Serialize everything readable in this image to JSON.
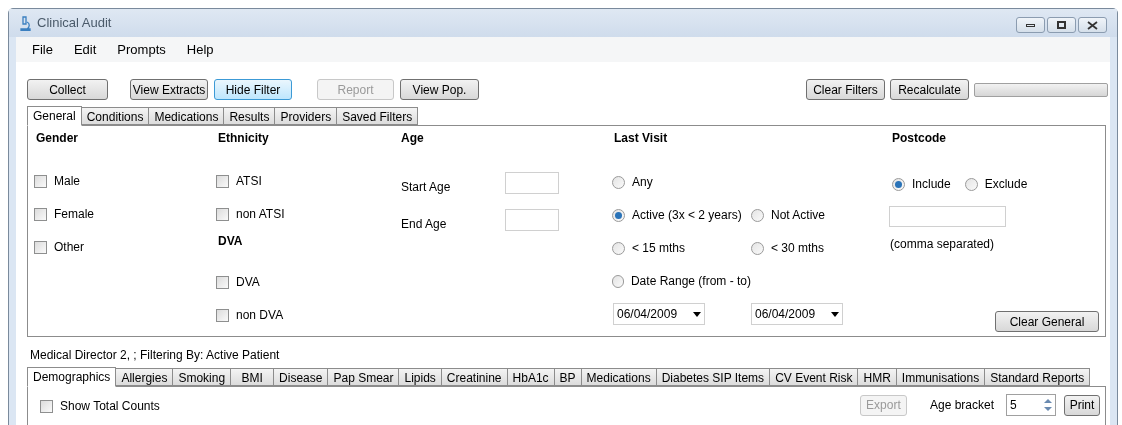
{
  "window": {
    "title": "Clinical Audit"
  },
  "menu": [
    "File",
    "Edit",
    "Prompts",
    "Help"
  ],
  "toolbar_left": [
    {
      "label": "Collect",
      "disabled": false,
      "focused": false
    },
    {
      "label": "View Extracts",
      "disabled": false,
      "focused": false
    },
    {
      "label": "Hide Filter",
      "disabled": false,
      "focused": true
    },
    {
      "label": "Report",
      "disabled": true,
      "focused": false
    },
    {
      "label": "View Pop.",
      "disabled": false,
      "focused": false
    }
  ],
  "toolbar_right": [
    {
      "label": "Clear Filters",
      "disabled": false,
      "focused": false
    },
    {
      "label": "Recalculate",
      "disabled": false,
      "focused": false
    }
  ],
  "progress": {
    "level": 0
  },
  "filter_tabs": [
    {
      "label": "General",
      "selected": true
    },
    {
      "label": "Conditions",
      "selected": false
    },
    {
      "label": "Medications",
      "selected": false
    },
    {
      "label": "Results",
      "selected": false
    },
    {
      "label": "Providers",
      "selected": false
    },
    {
      "label": "Saved Filters",
      "selected": false
    }
  ],
  "gender": {
    "heading": "Gender",
    "options": [
      {
        "label": "Male",
        "checked": false
      },
      {
        "label": "Female",
        "checked": false
      },
      {
        "label": "Other",
        "checked": false
      }
    ]
  },
  "ethnicity": {
    "heading": "Ethnicity",
    "options": [
      {
        "label": "ATSI",
        "checked": false
      },
      {
        "label": "non ATSI",
        "checked": false
      }
    ]
  },
  "dva": {
    "heading": "DVA",
    "options": [
      {
        "label": "DVA",
        "checked": false
      },
      {
        "label": "non DVA",
        "checked": false
      }
    ]
  },
  "age": {
    "heading": "Age",
    "fields": [
      {
        "label": "Start Age"
      },
      {
        "label": "End Age"
      }
    ]
  },
  "last_visit": {
    "heading": "Last Visit",
    "rows": [
      [
        {
          "label": "Any",
          "selected": false
        }
      ],
      [
        {
          "label": "Active (3x < 2 years)",
          "selected": true
        },
        {
          "label": "Not Active",
          "selected": false
        }
      ],
      [
        {
          "label": "< 15 mths",
          "selected": false
        },
        {
          "label": "< 30 mths",
          "selected": false
        }
      ],
      [
        {
          "label": "Date Range (from - to)",
          "selected": false
        }
      ]
    ],
    "dates": [
      "06/04/2009",
      "06/04/2009"
    ]
  },
  "postcode": {
    "heading": "Postcode",
    "options": [
      {
        "label": "Include",
        "selected": true
      },
      {
        "label": "Exclude",
        "selected": false
      }
    ],
    "hint": "(comma separated)"
  },
  "clear_general": {
    "label": "Clear General"
  },
  "status": "Medical Director 2, ; Filtering By: Active Patient",
  "result_tabs": [
    {
      "label": "Demographics",
      "selected": true
    },
    {
      "label": "Allergies",
      "selected": false
    },
    {
      "label": "Smoking",
      "selected": false
    },
    {
      "label": "BMI",
      "selected": false
    },
    {
      "label": "Disease",
      "selected": false
    },
    {
      "label": "Pap Smear",
      "selected": false
    },
    {
      "label": "Lipids",
      "selected": false
    },
    {
      "label": "Creatinine",
      "selected": false
    },
    {
      "label": "HbA1c",
      "selected": false
    },
    {
      "label": "BP",
      "selected": false
    },
    {
      "label": "Medications",
      "selected": false
    },
    {
      "label": "Diabetes SIP Items",
      "selected": false
    },
    {
      "label": "CV Event Risk",
      "selected": false
    },
    {
      "label": "HMR",
      "selected": false
    },
    {
      "label": "Immunisations",
      "selected": false
    },
    {
      "label": "Standard Reports",
      "selected": false
    }
  ],
  "show_total_counts": {
    "label": "Show Total Counts",
    "checked": false
  },
  "export": {
    "label": "Export",
    "disabled": true
  },
  "age_bracket": {
    "label": "Age bracket",
    "value": "5"
  },
  "print": {
    "label": "Print"
  }
}
